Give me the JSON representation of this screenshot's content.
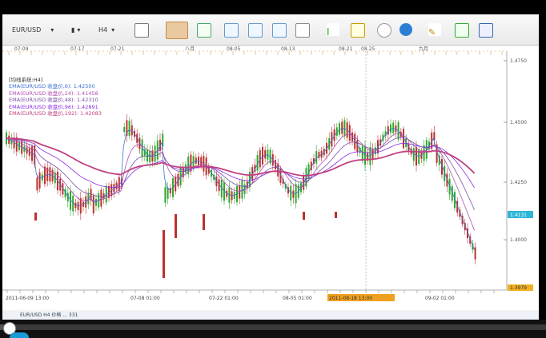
{
  "toolbar": {
    "symbol": "EUR/USD",
    "period": "H4",
    "colors": {
      "selected_bg": "#e8c9a0"
    }
  },
  "chart_data": {
    "type": "candlestick",
    "series": [
      {
        "name": "EMA(EUR/USD 收盘价,6)",
        "color": "#3b6fd1",
        "value": "1.42500"
      },
      {
        "name": "EMA(EUR/USD 收盘价,24)",
        "color": "#b04fb0",
        "value": "1.41458"
      },
      {
        "name": "EMA(EUR/USD 收盘价,48)",
        "color": "#7a4fa8",
        "value": "1.42310"
      },
      {
        "name": "EMA(EUR/USD 收盘价,96)",
        "color": "#8a2be2",
        "value": "1.42891"
      },
      {
        "name": "EMA(EUR/USD 收盘价,192)",
        "color": "#c04080",
        "value": "1.42083"
      }
    ],
    "indicator_title": "[均线系统:H4]",
    "y_ticks": [
      "1.4750",
      "1.4500",
      "1.4250",
      "1.4000"
    ],
    "current_price": "1.4131",
    "low_marker": "1.3979",
    "top_dates": [
      "07-09",
      "07-17",
      "07-21",
      "八月",
      "08-05",
      "08-13",
      "08-21",
      "08-25",
      "九月"
    ],
    "bottom_dates": [
      "2011-06-09 13:00",
      "07-08 01:00",
      "07-22 01:00",
      "08-05 01:00",
      "2011-08-18 13:00",
      "09-02 01:00"
    ],
    "ylim": [
      1.39,
      1.48
    ]
  },
  "status": {
    "text": "EUR/USD  H4  价格  ...  331"
  },
  "player": {
    "progress": 0.02
  }
}
